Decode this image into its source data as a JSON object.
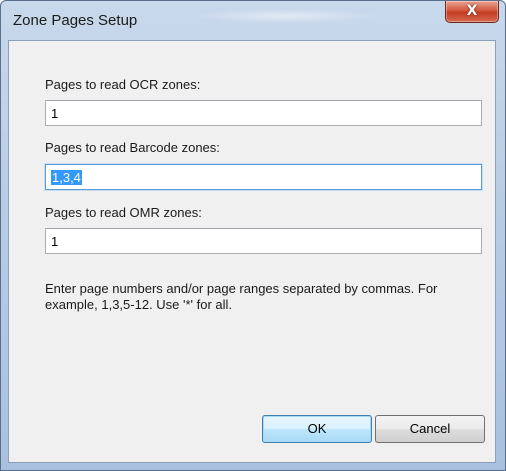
{
  "window": {
    "title": "Zone Pages Setup",
    "close_symbol": "X"
  },
  "form": {
    "ocr": {
      "label": "Pages to read OCR zones:",
      "value": "1"
    },
    "barcode": {
      "label": "Pages to read Barcode zones:",
      "value": "1,3,4"
    },
    "omr": {
      "label": "Pages to read OMR zones:",
      "value": "1"
    },
    "hint": "Enter page numbers and/or page ranges separated by commas. For example, 1,3,5-12. Use '*' for all."
  },
  "buttons": {
    "ok": "OK",
    "cancel": "Cancel"
  },
  "colors": {
    "selection": "#3399ff",
    "close_button": "#c23b22",
    "focus_border": "#5a9bd5"
  }
}
